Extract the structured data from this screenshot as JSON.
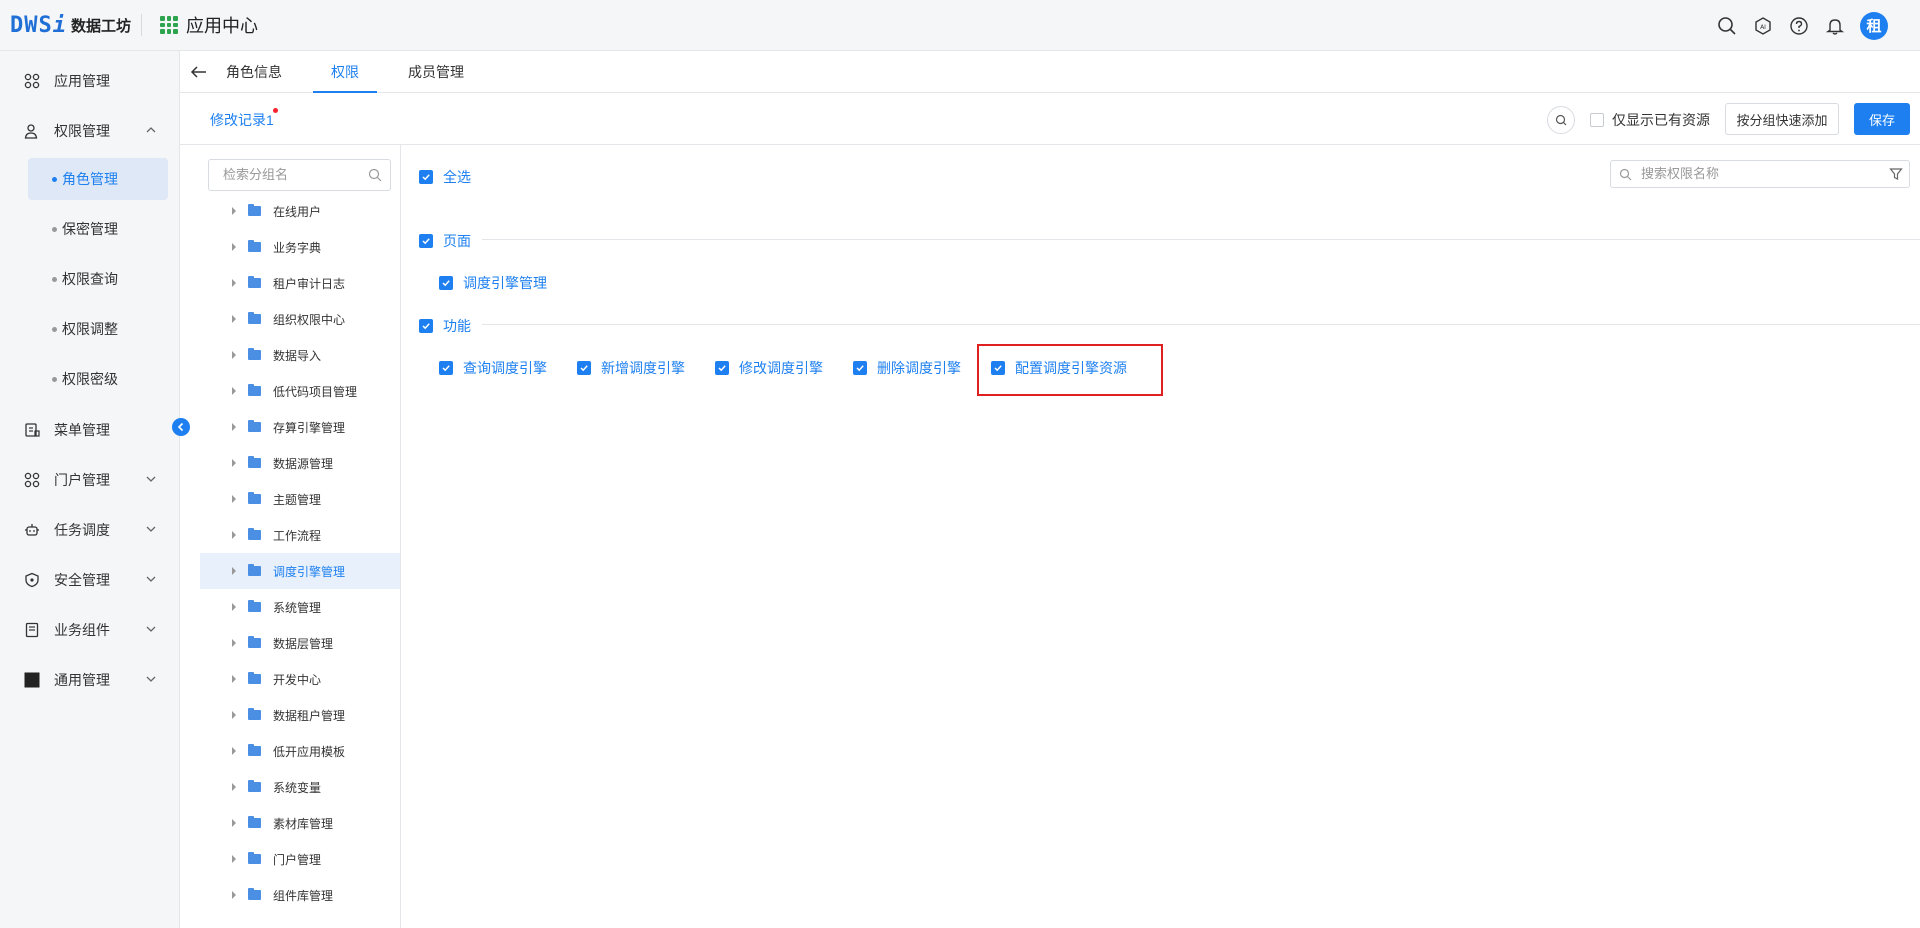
{
  "header": {
    "logo_mark": "DWS",
    "logo_mark_i": "i",
    "logo_text": "数据工坊",
    "app_title": "应用中心",
    "avatar_text": "租"
  },
  "sidebar": {
    "items": [
      {
        "label": "应用管理",
        "icon": "apps-icon"
      },
      {
        "label": "权限管理",
        "icon": "user-lock-icon",
        "expanded": true
      },
      {
        "label": "菜单管理",
        "icon": "menu-doc-icon"
      },
      {
        "label": "门户管理",
        "icon": "portal-grid-icon"
      },
      {
        "label": "任务调度",
        "icon": "robot-icon"
      },
      {
        "label": "安全管理",
        "icon": "shield-icon"
      },
      {
        "label": "业务组件",
        "icon": "component-icon"
      },
      {
        "label": "通用管理",
        "icon": "square-icon"
      }
    ],
    "sub_items": [
      "角色管理",
      "保密管理",
      "权限查询",
      "权限调整",
      "权限密级"
    ],
    "active_sub": "角色管理"
  },
  "tabs": {
    "items": [
      "角色信息",
      "权限",
      "成员管理"
    ],
    "active": "权限"
  },
  "toolbar": {
    "modify_record": "修改记录1",
    "only_show_label": "仅显示已有资源",
    "quick_add_label": "按分组快速添加",
    "save_label": "保存"
  },
  "tree": {
    "search_placeholder": "检索分组名",
    "items": [
      "在线用户",
      "业务字典",
      "租户审计日志",
      "组织权限中心",
      "数据导入",
      "低代码项目管理",
      "存算引擎管理",
      "数据源管理",
      "主题管理",
      "工作流程",
      "调度引擎管理",
      "系统管理",
      "数据层管理",
      "开发中心",
      "数据租户管理",
      "低开应用模板",
      "系统变量",
      "素材库管理",
      "门户管理",
      "组件库管理"
    ],
    "active": "调度引擎管理"
  },
  "permissions": {
    "select_all": "全选",
    "search_placeholder": "搜索权限名称",
    "page_section": "页面",
    "page_items": [
      "调度引擎管理"
    ],
    "function_section": "功能",
    "function_items": [
      "查询调度引擎",
      "新增调度引擎",
      "修改调度引擎",
      "删除调度引擎",
      "配置调度引擎资源"
    ]
  },
  "colors": {
    "accent": "#1e80f0",
    "highlight": "#e02020"
  }
}
